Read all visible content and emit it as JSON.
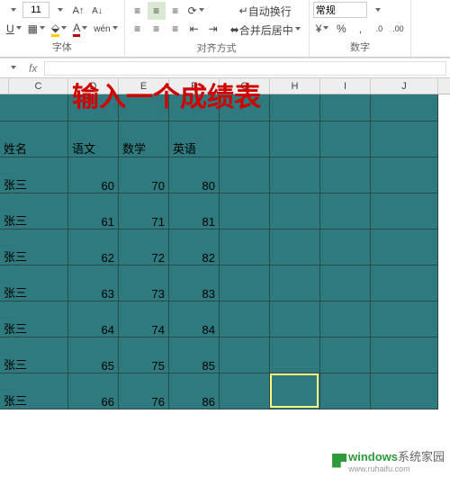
{
  "ribbon": {
    "font_size": "11",
    "group_font": "字体",
    "group_align": "对齐方式",
    "group_number": "数字",
    "wrap_text": "自动换行",
    "merge_center": "合并后居中",
    "number_format": "常规",
    "percent": "%",
    "comma": ",",
    "increase_dec": ".0→.00",
    "decrease_dec": ".00→.0"
  },
  "formula_bar": {
    "fx": "fx"
  },
  "columns": [
    "C",
    "D",
    "E",
    "F",
    "G",
    "H",
    "I",
    "J"
  ],
  "overlay": "输入一个成绩表",
  "headers": {
    "name": "姓名",
    "chinese": "语文",
    "math": "数学",
    "english": "英语"
  },
  "rows": [
    {
      "name": "张三",
      "c": 60,
      "m": 70,
      "e": 80
    },
    {
      "name": "张三",
      "c": 61,
      "m": 71,
      "e": 81
    },
    {
      "name": "张三",
      "c": 62,
      "m": 72,
      "e": 82
    },
    {
      "name": "张三",
      "c": 63,
      "m": 73,
      "e": 83
    },
    {
      "name": "张三",
      "c": 64,
      "m": 74,
      "e": 84
    },
    {
      "name": "张三",
      "c": 65,
      "m": 75,
      "e": 85
    },
    {
      "name": "张三",
      "c": 66,
      "m": 76,
      "e": 86
    }
  ],
  "chart_data": {
    "type": "table",
    "title": "输入一个成绩表",
    "columns": [
      "姓名",
      "语文",
      "数学",
      "英语"
    ],
    "data": [
      [
        "张三",
        60,
        70,
        80
      ],
      [
        "张三",
        61,
        71,
        81
      ],
      [
        "张三",
        62,
        72,
        82
      ],
      [
        "张三",
        63,
        73,
        83
      ],
      [
        "张三",
        64,
        74,
        84
      ],
      [
        "张三",
        65,
        75,
        85
      ],
      [
        "张三",
        66,
        76,
        86
      ]
    ]
  },
  "colors": {
    "cell_bg": "#2e7a7e",
    "overlay_text": "#d00000",
    "selection": "#fff880"
  },
  "watermark": {
    "brand": "windows",
    "suffix": "系统家园",
    "url": "www.ruhaifu.com"
  }
}
